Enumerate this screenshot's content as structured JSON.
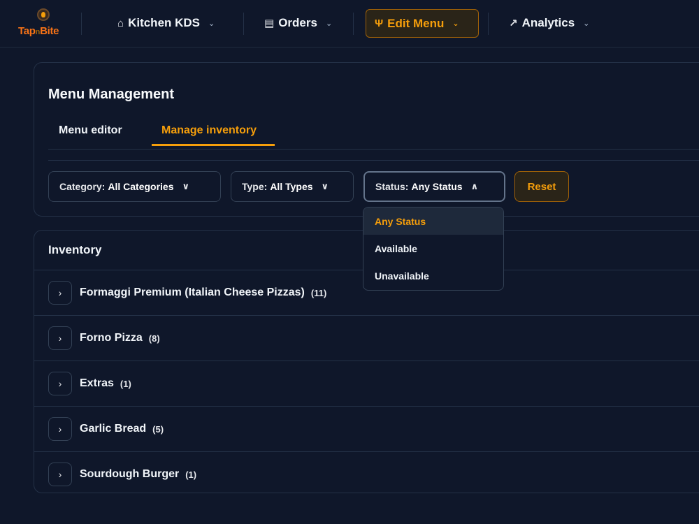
{
  "app": {
    "logo_part1": "Tap",
    "logo_part2": "n",
    "logo_part3": "Bite"
  },
  "nav": [
    {
      "label": "Kitchen KDS",
      "icon": "chef-hat-icon",
      "glyph": "⌂",
      "active": false
    },
    {
      "label": "Orders",
      "icon": "clipboard-icon",
      "glyph": "▤",
      "active": false
    },
    {
      "label": "Edit Menu",
      "icon": "utensils-icon",
      "glyph": "Ψ",
      "active": true
    },
    {
      "label": "Analytics",
      "icon": "trend-up-icon",
      "glyph": "↗",
      "active": false
    }
  ],
  "menu_management": {
    "title": "Menu Management",
    "tabs": [
      {
        "label": "Menu editor",
        "active": false
      },
      {
        "label": "Manage inventory",
        "active": true
      }
    ]
  },
  "filters": {
    "category": {
      "key": "Category:",
      "value": "All Categories"
    },
    "type": {
      "key": "Type:",
      "value": "All Types"
    },
    "status": {
      "key": "Status:",
      "value": "Any Status",
      "open": true
    },
    "reset_label": "Reset",
    "status_options": [
      "Any Status",
      "Available",
      "Unavailable"
    ],
    "status_selected": "Any Status"
  },
  "inventory": {
    "title": "Inventory",
    "categories": [
      {
        "name": "Formaggi Premium (Italian Cheese Pizzas)",
        "count": "(11)"
      },
      {
        "name": "Forno Pizza",
        "count": "(8)"
      },
      {
        "name": "Extras",
        "count": "(1)"
      },
      {
        "name": "Garlic Bread",
        "count": "(5)"
      },
      {
        "name": "Sourdough Burger",
        "count": "(1)"
      }
    ]
  },
  "colors": {
    "background": "#0f172a",
    "accent": "#f59e0b",
    "border": "#243147"
  }
}
